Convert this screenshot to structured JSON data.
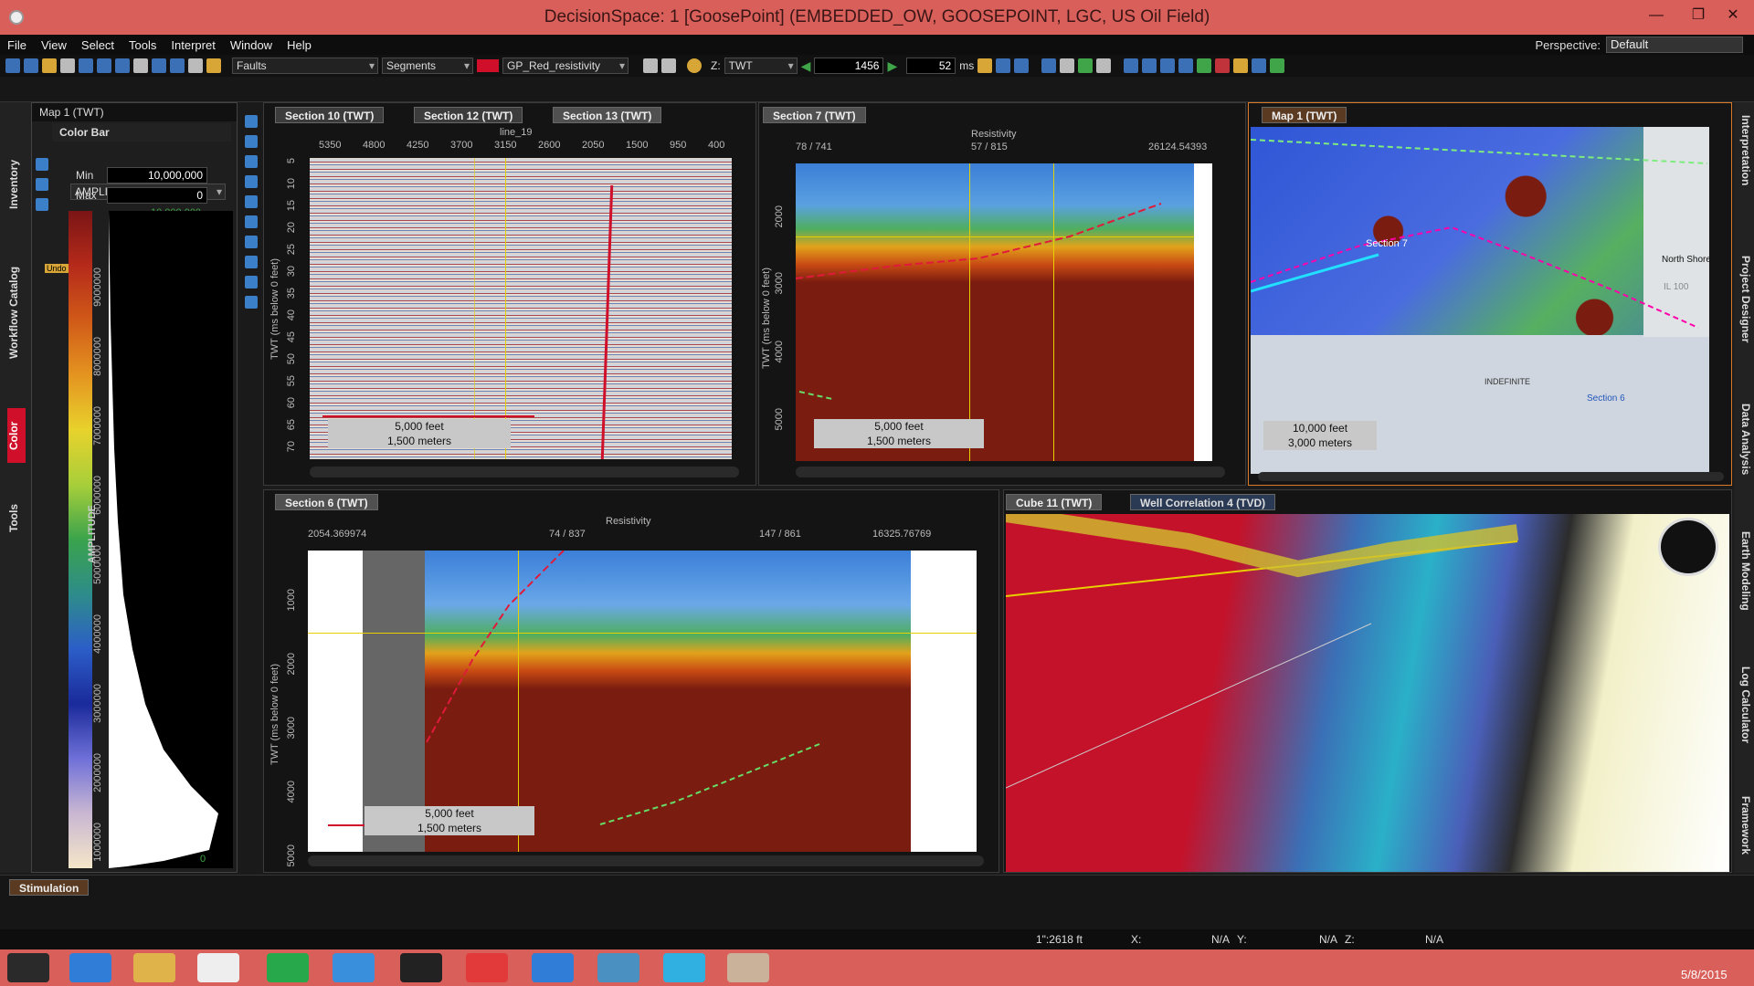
{
  "window": {
    "title": "DecisionSpace: 1 [GoosePoint] (EMBEDDED_OW, GOOSEPOINT, LGC, US Oil Field)"
  },
  "menu": [
    "File",
    "View",
    "Select",
    "Tools",
    "Interpret",
    "Window",
    "Help"
  ],
  "perspective": {
    "label": "Perspective:",
    "value": "Default"
  },
  "toolbar": {
    "faults": "Faults",
    "segments": "Segments",
    "property": "GP_Red_resistivity",
    "domain": "TWT",
    "domain_prefix": "Z:",
    "time_value": "1456",
    "step_value": "52",
    "step_unit": "ms"
  },
  "left_panel": {
    "title": "Map 1 (TWT)",
    "colorbar_title": "Color Bar",
    "attribute": "AMPLITUDE / Permitti...",
    "min_label": "Min",
    "min_value": "10,000,000",
    "max_label": "Max",
    "max_value": "0",
    "top_value": "10,000,000",
    "bottom_value": "0",
    "axis_title": "AMPLITUDE",
    "ticks": [
      "9000000",
      "8000000",
      "7000000",
      "6000000",
      "5000000",
      "4000000",
      "3000000",
      "2000000",
      "1000000"
    ],
    "undo_label": "Undo"
  },
  "left_tabs": [
    "Inventory",
    "Workflow Catalog",
    "Color",
    "Tools"
  ],
  "right_tabs": [
    "Interpretation",
    "Project Designer",
    "Data Analysis",
    "Earth Modeling",
    "Log Calculator",
    "Framework"
  ],
  "tabs_top": [
    {
      "label": "Section 10 (TWT)"
    },
    {
      "label": "Section 12 (TWT)"
    },
    {
      "label": "Section 13 (TWT)"
    }
  ],
  "section13": {
    "line_label": "line_19",
    "x_ticks": [
      "5350",
      "4800",
      "4250",
      "3700",
      "3150",
      "2600",
      "2050",
      "1500",
      "950",
      "400"
    ],
    "y_ticks": [
      "5",
      "10",
      "15",
      "20",
      "25",
      "30",
      "35",
      "40",
      "45",
      "50",
      "55",
      "60",
      "65",
      "70"
    ],
    "y_axis": "TWT (ms below 0 feet)",
    "scale_feet": "5,000 feet",
    "scale_m": "1,500 meters"
  },
  "section7": {
    "tab": "Section 7 (TWT)",
    "prop": "Resistivity",
    "x_left": "78 / 741",
    "x_mid": "57 / 815",
    "x_right": "26124.54393",
    "y_ticks": [
      "2000",
      "3000",
      "4000",
      "5000"
    ],
    "y_axis": "TWT (ms below 0 feet)",
    "scale_feet": "5,000 feet",
    "scale_m": "1,500 meters"
  },
  "map1": {
    "tab": "Map 1 (TWT)",
    "scale_feet": "10,000 feet",
    "scale_m": "3,000 meters",
    "labels": [
      "Section 7",
      "North Shore",
      "INDEFINITE",
      "IL 100",
      "Section 6"
    ]
  },
  "section6": {
    "tab": "Section 6 (TWT)",
    "prop": "Resistivity",
    "x_left": "2054.369974",
    "x_mid": "74 / 837",
    "x_mid2": "147 / 861",
    "x_right": "16325.76769",
    "y_ticks": [
      "1000",
      "2000",
      "3000",
      "4000",
      "5000"
    ],
    "y_axis": "TWT (ms below 0 feet)",
    "scale_feet": "5,000 feet",
    "scale_m": "1,500 meters"
  },
  "cube_tabs": [
    {
      "label": "Cube 11 (TWT)"
    },
    {
      "label": "Well Correlation 4 (TVD)"
    }
  ],
  "bottom": {
    "tab": "Stimulation"
  },
  "status": {
    "scale": "1\":2618 ft",
    "x_label": "X:",
    "x_val": "N/A",
    "y_label": "Y:",
    "y_val": "N/A",
    "z_label": "Z:",
    "z_val": "N/A"
  },
  "taskbar": {
    "time": "5/8/2015"
  },
  "colors": {
    "accent_red": "#d9605a",
    "fault_red": "#d0102a",
    "highlight": "#f0c020"
  }
}
